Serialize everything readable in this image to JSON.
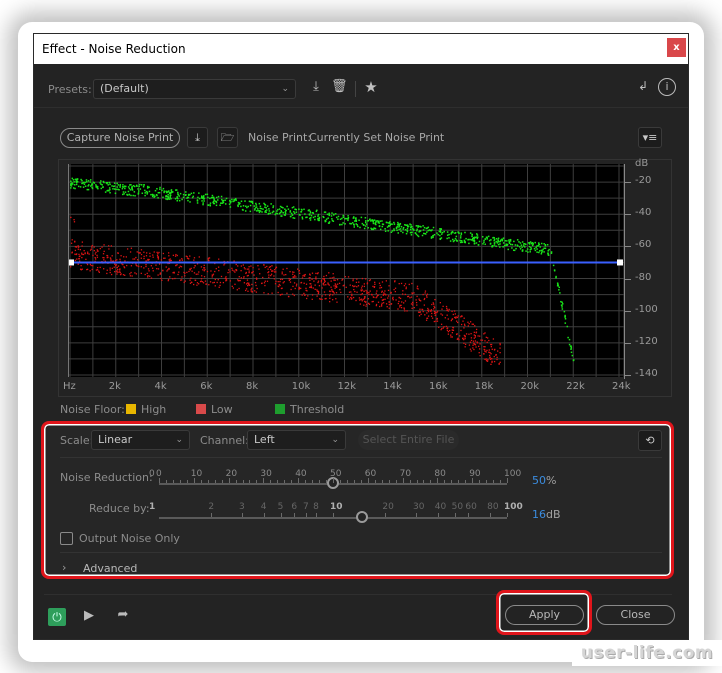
{
  "window": {
    "title": "Effect - Noise Reduction",
    "close_label": "x"
  },
  "presets": {
    "label": "Presets:",
    "value": "(Default)",
    "icons": [
      "download-preset-icon",
      "trash-icon",
      "star-icon"
    ]
  },
  "top_right_icons": [
    "routing-icon",
    "info-icon"
  ],
  "noise_print": {
    "capture_button": "Capture Noise Print",
    "label": "Noise Print:",
    "status": "Currently Set Noise Print",
    "icons": [
      "capture-download-icon",
      "folder-icon"
    ],
    "menu_icon": "menu-icon"
  },
  "graph": {
    "y_unit": "dB",
    "y_ticks": [
      "-20",
      "-40",
      "-60",
      "-80",
      "-100",
      "-120",
      "-140"
    ],
    "x_ticks": [
      "Hz",
      "2k",
      "4k",
      "6k",
      "8k",
      "10k",
      "12k",
      "14k",
      "16k",
      "18k",
      "20k",
      "22k",
      "24k"
    ],
    "threshold_line_db": -70,
    "legend_label": "Noise Floor:",
    "legend": [
      {
        "name": "High",
        "color": "#e8b600"
      },
      {
        "name": "Low",
        "color": "#d94a4a"
      },
      {
        "name": "Threshold",
        "color": "#1e9e2e"
      }
    ],
    "colors": {
      "high_points": "#19e619",
      "low_points": "#e01414",
      "threshold_line": "#3a5fff"
    }
  },
  "controls": {
    "scale_label": "Scale:",
    "scale_value": "Linear",
    "channel_label": "Channel:",
    "channel_value": "Left",
    "select_entire_file": "Select Entire File",
    "reset_icon": "reset-icon",
    "noise_reduction": {
      "label": "Noise Reduction:",
      "scale": [
        "0",
        "0",
        "10",
        "20",
        "30",
        "40",
        "50",
        "60",
        "70",
        "80",
        "90",
        "100"
      ],
      "value": "50",
      "unit": "%",
      "fraction": 0.5
    },
    "reduce_by": {
      "label": "Reduce by:",
      "scale": [
        "1",
        "2",
        "3",
        "4",
        "5",
        "6",
        "7",
        "8",
        "10",
        "20",
        "30",
        "40",
        "50",
        "60",
        "80",
        "100"
      ],
      "value": "16",
      "unit": "dB"
    },
    "output_noise_only": "Output Noise Only",
    "output_noise_only_checked": false,
    "advanced": "Advanced"
  },
  "footer": {
    "apply": "Apply",
    "close": "Close",
    "icons": [
      "power-icon",
      "play-icon",
      "export-icon"
    ]
  },
  "watermark": "user-life.com"
}
